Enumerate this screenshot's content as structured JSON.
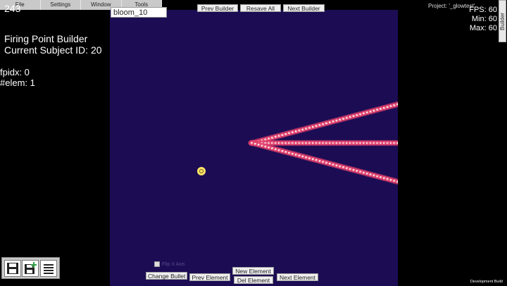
{
  "menu": [
    "File",
    "Settings",
    "Window",
    "Tools"
  ],
  "bullet_name_value": "bloom_10",
  "nav": {
    "prev_builder": "Prev Builder",
    "resave_all": "Resave All",
    "next_builder": "Next Builder"
  },
  "top_counter": "243",
  "project_label": "Project: '_glowtest'",
  "side_tab": "Builder",
  "fps": {
    "fps": "FPS: 60",
    "min": "Min: 60",
    "max": "Max: 60"
  },
  "builder": {
    "title": "Firing Point Builder",
    "subject": "Current Subject ID: 20"
  },
  "stats": {
    "fpidx": "fpidx: 0",
    "elem": "#elem: 1"
  },
  "checkbox_label": "Flip X Axis",
  "actions": {
    "change_bullet": "Change Bullet",
    "prev_element": "Prev Element",
    "new_element": "New Element",
    "del_element": "Del Element",
    "next_element": "Next Element"
  },
  "tools": [
    "save-icon",
    "save-new-icon",
    "list-icon"
  ],
  "dev_build": "Development Build",
  "colors": {
    "playfield": "#1c0c54",
    "bullet_rim": "#e0406c",
    "bullet_core": "#ffffff",
    "firing_point": "#ffe46a"
  }
}
